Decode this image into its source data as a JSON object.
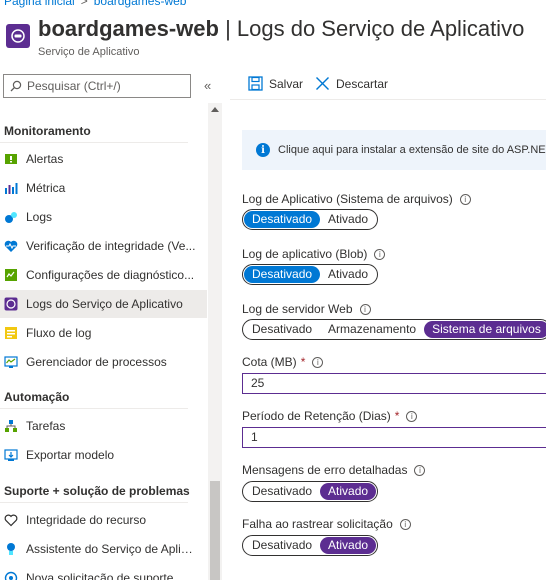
{
  "breadcrumb": {
    "home": "Página inicial",
    "separator": ">",
    "current": "boardgames-web"
  },
  "header": {
    "resource_name": "boardgames-web",
    "title_separator": "|",
    "page_title": "Logs do Serviço de Aplicativo",
    "subtitle": "Serviço de Aplicativo"
  },
  "sidebar": {
    "search_placeholder": "Pesquisar (Ctrl+/)",
    "collapse_glyph": "«",
    "sections": {
      "monitoring": "Monitoramento",
      "automation": "Automação",
      "support": "Suporte + solução de problemas"
    },
    "items": [
      {
        "label": "Alertas",
        "icon": "alerts-icon"
      },
      {
        "label": "Métrica",
        "icon": "metrics-icon"
      },
      {
        "label": "Logs",
        "icon": "logs-icon"
      },
      {
        "label": "Verificação de integridade (Ve...",
        "icon": "health-check-icon"
      },
      {
        "label": "Configurações de diagnóstico...",
        "icon": "diagnostic-settings-icon"
      },
      {
        "label": "Logs do Serviço de Aplicativo",
        "icon": "app-service-logs-icon",
        "active": true
      },
      {
        "label": "Fluxo de log",
        "icon": "log-stream-icon"
      },
      {
        "label": "Gerenciador de processos",
        "icon": "process-explorer-icon"
      },
      {
        "label": "Tarefas",
        "icon": "tasks-icon"
      },
      {
        "label": "Exportar modelo",
        "icon": "export-template-icon"
      },
      {
        "label": "Integridade do recurso",
        "icon": "resource-health-icon"
      },
      {
        "label": "Assistente do Serviço de Aplic...",
        "icon": "app-service-advisor-icon"
      },
      {
        "label": "Nova solicitação de suporte",
        "icon": "support-request-icon"
      }
    ]
  },
  "toolbar": {
    "save_label": "Salvar",
    "discard_label": "Descartar"
  },
  "info_banner": {
    "text": "Clique aqui para instalar a extensão de site do ASP.NET Core"
  },
  "settings": {
    "app_log_fs": {
      "label": "Log de Aplicativo (Sistema de arquivos)",
      "options": [
        "Desativado",
        "Ativado"
      ],
      "selected": "Desativado"
    },
    "app_log_blob": {
      "label": "Log de aplicativo (Blob)",
      "options": [
        "Desativado",
        "Ativado"
      ],
      "selected": "Desativado"
    },
    "web_server_log": {
      "label": "Log de servidor Web",
      "options": [
        "Desativado",
        "Armazenamento",
        "Sistema de arquivos"
      ],
      "selected": "Sistema de arquivos"
    },
    "quota": {
      "label": "Cota (MB)",
      "required_mark": "*",
      "value": "25"
    },
    "retention": {
      "label": "Período de Retenção (Dias)",
      "required_mark": "*",
      "value": "1"
    },
    "detailed_errors": {
      "label": "Mensagens de erro detalhadas",
      "options": [
        "Desativado",
        "Ativado"
      ],
      "selected": "Ativado"
    },
    "failed_request_tracing": {
      "label": "Falha ao rastrear solicitação",
      "options": [
        "Desativado",
        "Ativado"
      ],
      "selected": "Ativado"
    }
  },
  "colors": {
    "accent_blue": "#0078d4",
    "accent_purple": "#5c2d91",
    "selected_bg": "#edebe9"
  }
}
